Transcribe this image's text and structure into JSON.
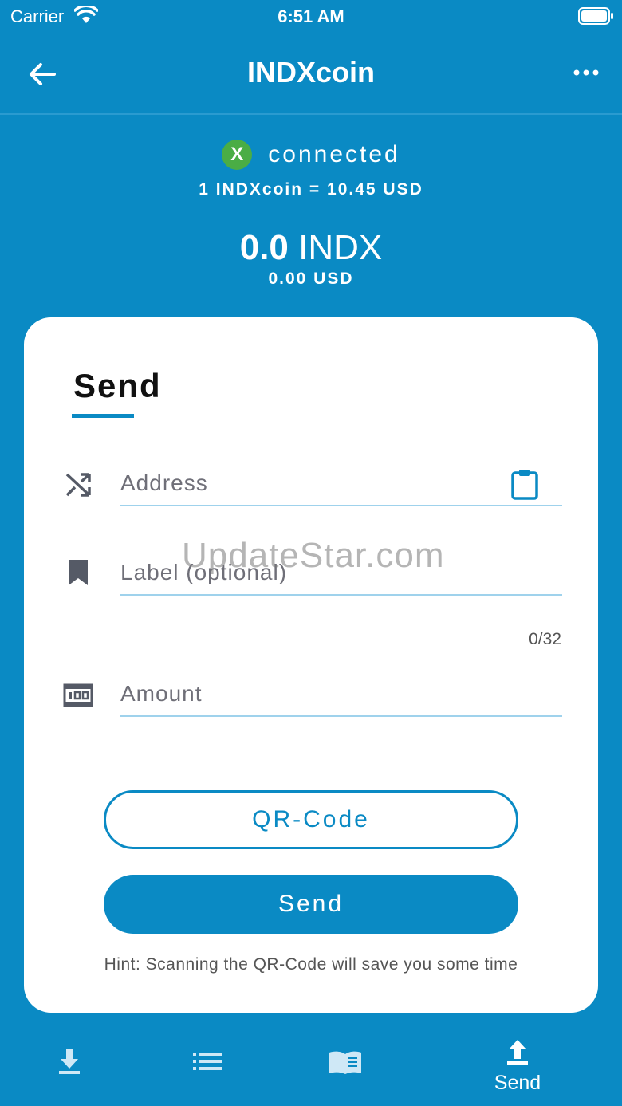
{
  "status_bar": {
    "carrier": "Carrier",
    "time": "6:51 AM"
  },
  "nav": {
    "title": "INDXcoin"
  },
  "connection": {
    "badge": "X",
    "status": "connected",
    "rate": "1 INDXcoin = 10.45 USD"
  },
  "balance": {
    "amount": "0.0",
    "unit": "INDX",
    "usd": "0.00 USD"
  },
  "send_form": {
    "title": "Send",
    "address_placeholder": "Address",
    "label_placeholder": "Label (optional)",
    "label_counter": "0/32",
    "amount_placeholder": "Amount",
    "qr_button": "QR-Code",
    "send_button": "Send",
    "hint": "Hint: Scanning the QR-Code will save you some time"
  },
  "watermark": "UpdateStar.com",
  "tabs": [
    {
      "icon": "download-icon",
      "label": ""
    },
    {
      "icon": "list-icon",
      "label": ""
    },
    {
      "icon": "book-icon",
      "label": ""
    },
    {
      "icon": "upload-icon",
      "label": "Send"
    }
  ],
  "colors": {
    "primary": "#0a8ac4",
    "connected_badge": "#4aad45",
    "card": "#ffffff"
  }
}
